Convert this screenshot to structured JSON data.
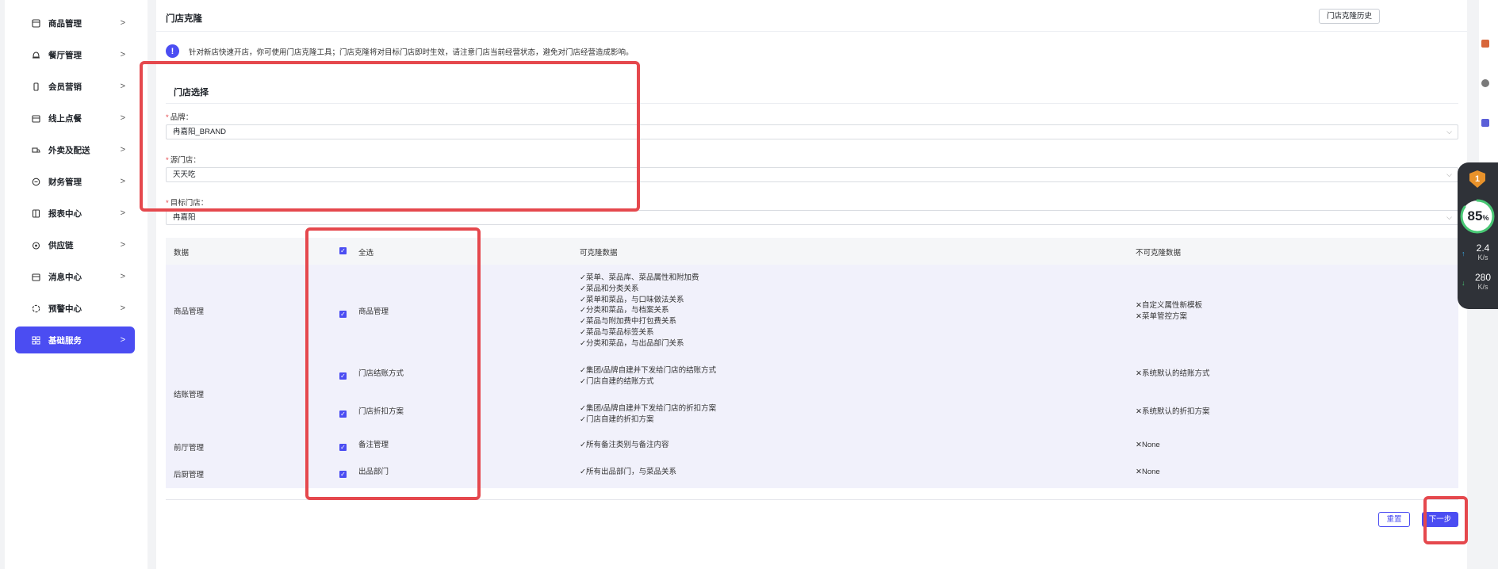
{
  "sidebar": {
    "items": [
      {
        "label": "商品管理",
        "icon": "box-icon"
      },
      {
        "label": "餐厅管理",
        "icon": "bell-icon"
      },
      {
        "label": "会员营销",
        "icon": "phone-icon"
      },
      {
        "label": "线上点餐",
        "icon": "calendar-icon"
      },
      {
        "label": "外卖及配送",
        "icon": "truck-icon"
      },
      {
        "label": "财务管理",
        "icon": "money-icon"
      },
      {
        "label": "报表中心",
        "icon": "report-icon"
      },
      {
        "label": "供应链",
        "icon": "link-icon"
      },
      {
        "label": "消息中心",
        "icon": "message-icon"
      },
      {
        "label": "预警中心",
        "icon": "alert-icon"
      },
      {
        "label": "基础服务",
        "icon": "grid-icon"
      }
    ],
    "chevron": ">"
  },
  "header": {
    "title": "门店克隆",
    "history_button": "门店克隆历史"
  },
  "notice": {
    "icon": "!",
    "text": "针对新店快速开店，你可使用门店克隆工具；门店克隆将对目标门店即时生效，请注意门店当前经营状态，避免对门店经营造成影响。"
  },
  "store_select": {
    "section_title": "门店选择",
    "required_mark": "*",
    "brand": {
      "label": "品牌：",
      "value": "冉嘉阳_BRAND"
    },
    "source": {
      "label": "源门店：",
      "value": "天天吃"
    },
    "target": {
      "label": "目标门店：",
      "value": "冉嘉阳"
    },
    "arrow": "⌵"
  },
  "table": {
    "headers": {
      "data": "数据",
      "select_all": "全选",
      "cloneable": "可克隆数据",
      "not_cloneable": "不可克隆数据"
    },
    "groups": [
      {
        "name": "商品管理"
      },
      {
        "name": "结账管理"
      },
      {
        "name": "前厅管理"
      },
      {
        "name": "后厨管理"
      }
    ],
    "rows": [
      {
        "item": "商品管理",
        "cloneable": [
          "✓菜单、菜品库、菜品属性和附加费",
          "✓菜品和分类关系",
          "✓菜单和菜品，与口味做法关系",
          "✓分类和菜品，与档案关系",
          "✓菜品与附加费中打包费关系",
          "✓菜品与菜品标签关系",
          "✓分类和菜品，与出品部门关系"
        ],
        "not_cloneable": [
          "✕自定义属性新模板",
          "✕菜单管控方案"
        ]
      },
      {
        "item": "门店结账方式",
        "cloneable": [
          "✓集团/品牌自建并下发给门店的结账方式",
          "✓门店自建的结账方式"
        ],
        "not_cloneable": [
          "✕系统默认的结账方式"
        ]
      },
      {
        "item": "门店折扣方案",
        "cloneable": [
          "✓集团/品牌自建并下发给门店的折扣方案",
          "✓门店自建的折扣方案"
        ],
        "not_cloneable": [
          "✕系统默认的折扣方案"
        ]
      },
      {
        "item": "备注管理",
        "cloneable": [
          "✓所有备注类别与备注内容"
        ],
        "not_cloneable": [
          "✕None"
        ]
      },
      {
        "item": "出品部门",
        "cloneable": [
          "✓所有出品部门，与菜品关系"
        ],
        "not_cloneable": [
          "✕None"
        ]
      }
    ]
  },
  "actions": {
    "reset": "重置",
    "next": "下一步"
  },
  "widget": {
    "badge": "1",
    "percent": "85",
    "percent_unit": "%",
    "upload": "2.4",
    "download": "280",
    "speed_unit": "K/s"
  },
  "colors": {
    "accent": "#4b4df2",
    "highlight": "#e5484d"
  }
}
